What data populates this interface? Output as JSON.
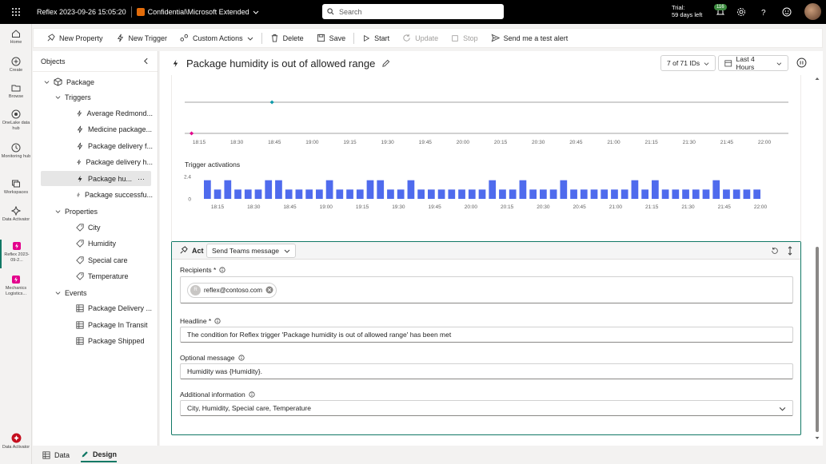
{
  "topbar": {
    "title": "Reflex 2023-09-26 15:05:20",
    "sensitivity": "Confidential\\Microsoft Extended",
    "search_placeholder": "Search",
    "trial_line1": "Trial:",
    "trial_line2": "59 days left",
    "notifications": "116"
  },
  "rail": [
    {
      "label": "Home"
    },
    {
      "label": "Create"
    },
    {
      "label": "Browse"
    },
    {
      "label": "OneLake data hub"
    },
    {
      "label": "Monitoring hub"
    },
    {
      "label": "Workspaces"
    },
    {
      "label": "Data Activator"
    },
    {
      "label": "Reflex 2023-09-2..."
    },
    {
      "label": "Mechanics Logistics..."
    },
    {
      "label": "Data Activator"
    }
  ],
  "toolbar": {
    "new_property": "New Property",
    "new_trigger": "New Trigger",
    "custom_actions": "Custom Actions",
    "delete": "Delete",
    "save": "Save",
    "start": "Start",
    "update": "Update",
    "stop": "Stop",
    "test_alert": "Send me a test alert"
  },
  "objects": {
    "header": "Objects",
    "package": "Package",
    "triggers_label": "Triggers",
    "triggers": [
      "Average Redmond...",
      "Medicine package...",
      "Package delivery f...",
      "Package delivery h...",
      "Package hu...",
      "Package successfu..."
    ],
    "properties_label": "Properties",
    "properties": [
      "City",
      "Humidity",
      "Special care",
      "Temperature"
    ],
    "events_label": "Events",
    "events": [
      "Package Delivery ...",
      "Package In Transit",
      "Package Shipped"
    ]
  },
  "main": {
    "title": "Package humidity is out of allowed range",
    "ids": "7 of 71 IDs",
    "time_range": "Last 4 Hours"
  },
  "chart_data": [
    {
      "type": "scatter",
      "x": [
        "18:15",
        "18:30",
        "18:45",
        "19:00",
        "19:15",
        "19:30",
        "19:45",
        "20:00",
        "20:15",
        "20:30",
        "20:45",
        "21:00",
        "21:15",
        "21:30",
        "21:45",
        "22:00"
      ],
      "points": [
        {
          "x": "18:12",
          "series": "pink"
        },
        {
          "x": "18:44",
          "series": "teal"
        }
      ],
      "colors": {
        "pink": "#e3008c",
        "teal": "#0f9bab"
      }
    },
    {
      "type": "bar",
      "title": "Trigger activations",
      "ylim": [
        0,
        2.4
      ],
      "yticks": [
        "2.4",
        "0"
      ],
      "xticks": [
        "18:15",
        "18:30",
        "18:45",
        "19:00",
        "19:15",
        "19:30",
        "19:45",
        "20:00",
        "20:15",
        "20:30",
        "20:45",
        "21:00",
        "21:15",
        "21:30",
        "21:45",
        "22:00"
      ],
      "values": [
        2,
        1,
        2,
        1,
        1,
        1,
        2,
        2,
        1,
        1,
        1,
        1,
        2,
        1,
        1,
        1,
        2,
        2,
        1,
        1,
        2,
        1,
        1,
        1,
        1,
        1,
        1,
        1,
        2,
        1,
        1,
        2,
        1,
        1,
        1,
        2,
        1,
        1,
        1,
        1,
        1,
        1,
        2,
        1,
        2,
        1,
        1,
        1,
        1,
        1,
        2,
        1,
        1,
        1,
        1
      ],
      "bar_color": "#4f6bed"
    }
  ],
  "act": {
    "label": "Act",
    "action_type": "Send Teams message",
    "recipients_label": "Recipients *",
    "recipient": "reflex@contoso.com",
    "recipient_initial": "R",
    "headline_label": "Headline *",
    "headline": "The condition for Reflex trigger 'Package humidity is out of allowed range' has been met",
    "optional_label": "Optional message",
    "optional": "Humidity was {Humidity}.",
    "additional_label": "Additional information",
    "additional": "City, Humidity, Special care, Temperature"
  },
  "bottom_tabs": {
    "data": "Data",
    "design": "Design"
  }
}
